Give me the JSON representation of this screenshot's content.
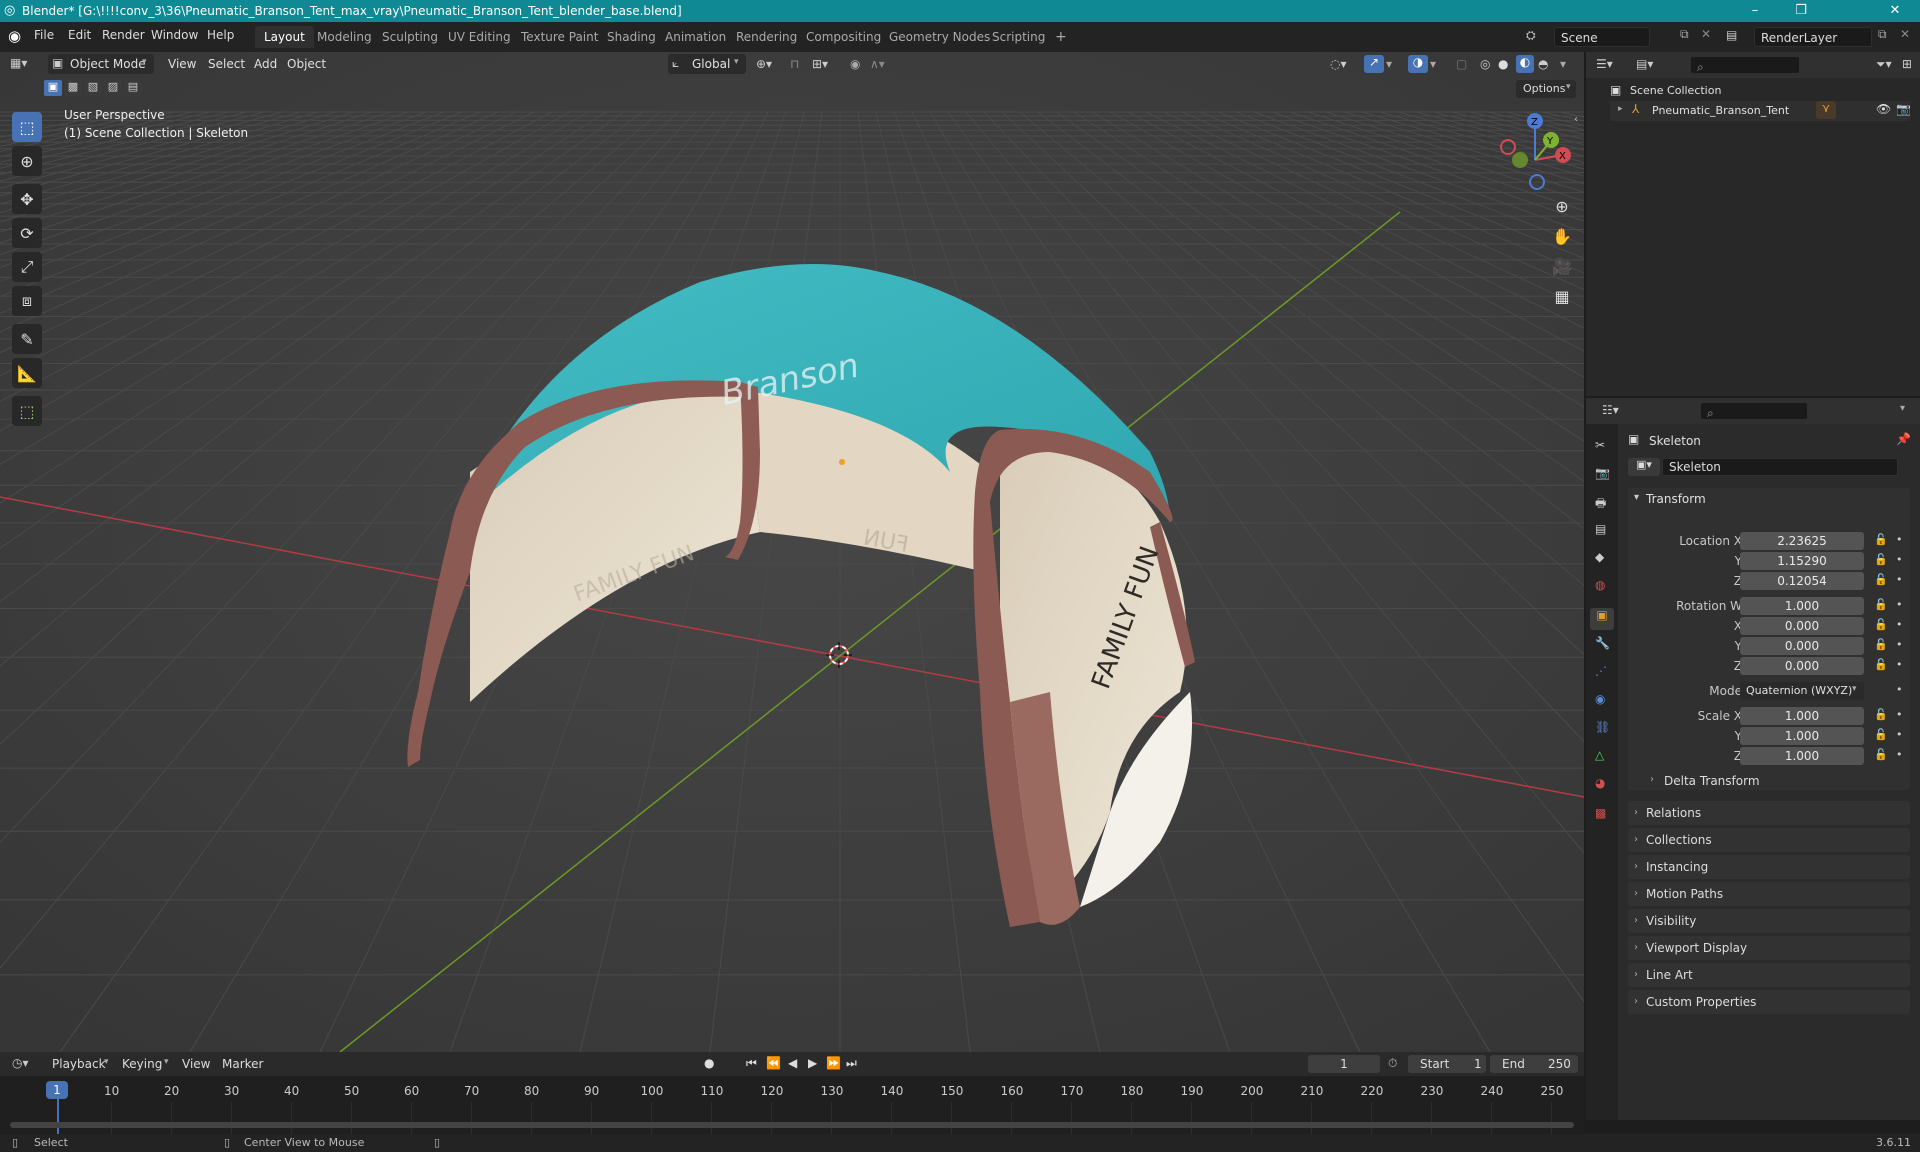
{
  "window": {
    "title": "Blender* [G:\\!!!!conv_3\\36\\Pneumatic_Branson_Tent_max_vray\\Pneumatic_Branson_Tent_blender_base.blend]",
    "minimize": "–",
    "maximize": "❐",
    "close": "✕"
  },
  "menu": [
    "File",
    "Edit",
    "Render",
    "Window",
    "Help"
  ],
  "workspaces": [
    "Layout",
    "Modeling",
    "Sculpting",
    "UV Editing",
    "Texture Paint",
    "Shading",
    "Animation",
    "Rendering",
    "Compositing",
    "Geometry Nodes",
    "Scripting"
  ],
  "active_workspace": "Layout",
  "add_workspace": "+",
  "scene": {
    "name": "Scene",
    "render_layer": "RenderLayer"
  },
  "viewport": {
    "mode": "Object Mode",
    "menus": [
      "View",
      "Select",
      "Add",
      "Object"
    ],
    "transform_orientation": "Global",
    "options_label": "Options",
    "overlay_line1": "User Perspective",
    "overlay_line2": "(1) Scene Collection | Skeleton",
    "gizmo": {
      "x": "X",
      "y": "Y",
      "z": "Z"
    },
    "tent_text": {
      "logo": "Branson",
      "side": "FAMILY FUN",
      "back": "FUN",
      "back_left": "FAMILY FUN"
    }
  },
  "outliner": {
    "root": "Scene Collection",
    "items": [
      {
        "name": "Pneumatic_Branson_Tent"
      }
    ]
  },
  "properties": {
    "object_name": "Skeleton",
    "data_name": "Skeleton",
    "transform_header": "Transform",
    "location": {
      "label": "Location X",
      "x": "2.23625",
      "y_label": "Y",
      "y": "1.15290",
      "z_label": "Z",
      "z": "0.12054"
    },
    "rotation": {
      "label": "Rotation W",
      "w": "1.000",
      "x_label": "X",
      "x": "0.000",
      "y_label": "Y",
      "y": "0.000",
      "z_label": "Z",
      "z": "0.000"
    },
    "mode_label": "Mode",
    "mode_value": "Quaternion (WXYZ)",
    "scale": {
      "label": "Scale X",
      "x": "1.000",
      "y_label": "Y",
      "y": "1.000",
      "z_label": "Z",
      "z": "1.000"
    },
    "delta_transform": "Delta Transform",
    "panels": [
      "Relations",
      "Collections",
      "Instancing",
      "Motion Paths",
      "Visibility",
      "Viewport Display",
      "Line Art",
      "Custom Properties"
    ]
  },
  "timeline": {
    "menus": [
      "Playback",
      "Keying",
      "View",
      "Marker"
    ],
    "current_frame": "1",
    "start_label": "Start",
    "start": "1",
    "end_label": "End",
    "end": "250",
    "ticks": [
      "1",
      "10",
      "20",
      "30",
      "40",
      "50",
      "60",
      "70",
      "80",
      "90",
      "100",
      "110",
      "120",
      "130",
      "140",
      "150",
      "160",
      "170",
      "180",
      "190",
      "200",
      "210",
      "220",
      "230",
      "240",
      "250"
    ]
  },
  "status": {
    "select": "Select",
    "center_view": "Center View to Mouse",
    "version": "3.6.11"
  },
  "colors": {
    "accent": "#4772b3",
    "titlebar": "#0f8a94",
    "tent_top": "#3fb8c0",
    "tent_frame": "#8b5a52",
    "tent_wall": "#e8dccb"
  }
}
